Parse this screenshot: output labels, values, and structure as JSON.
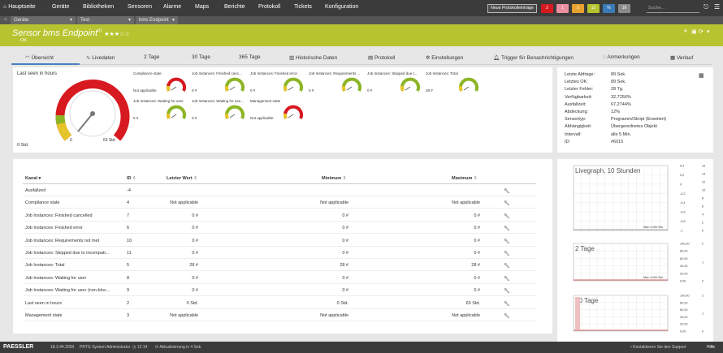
{
  "topnav": {
    "home": "Hauptseite",
    "items": [
      "Geräte",
      "Bibliotheken",
      "Sensoren",
      "Alarme",
      "Maps",
      "Berichte",
      "Protokoll",
      "Tickets",
      "Konfiguration"
    ],
    "newlog": "Neue Protokolleinträge",
    "search_placeholder": "Suche...",
    "chips": [
      {
        "v": "2",
        "c": "#d71920"
      },
      {
        "v": "1",
        "c": "#e98fa0"
      },
      {
        "v": "5",
        "c": "#e7a12e"
      },
      {
        "v": "12",
        "c": "#8cb526"
      },
      {
        "v": "%",
        "c": "#3a7bb7"
      },
      {
        "v": "16",
        "c": "#8a8a8a"
      }
    ]
  },
  "breadcrumb": [
    "Geräte",
    "Test",
    "bms Endpoint"
  ],
  "header": {
    "title": "Sensor bms Endpoint",
    "badge": "ID",
    "status": "OK",
    "stars": "★★★☆☆"
  },
  "tabs": [
    {
      "label": "Übersicht"
    },
    {
      "label": "Livedaten"
    },
    {
      "label": "2 Tage"
    },
    {
      "label": "30 Tage"
    },
    {
      "label": "365 Tage"
    },
    {
      "label": "Historische Daten"
    },
    {
      "label": "Protokoll"
    },
    {
      "label": "Einstellungen"
    },
    {
      "label": "Trigger für Benachrichtigungen"
    },
    {
      "label": "Anmerkungen"
    },
    {
      "label": "Verlauf"
    }
  ],
  "big_gauge": {
    "title": "Last seen in hours",
    "value": "0 Std.",
    "min": "0",
    "max": "63 Std."
  },
  "gauges": [
    {
      "title": "Compliance state",
      "value": "Not applicable",
      "kind": "small"
    },
    {
      "title": "Job Instances: Finished canc...",
      "value": "0 #",
      "kind": "small"
    },
    {
      "title": "Job Instances: Finished error",
      "value": "0 #",
      "kind": "small"
    },
    {
      "title": "Job Instances: Requirements ...",
      "value": "0 #",
      "kind": "small"
    },
    {
      "title": "Job Instances: Skipped due t...",
      "value": "0 #",
      "kind": "small"
    },
    {
      "title": "Job Instances: Total",
      "value": "28 #",
      "kind": "small"
    },
    {
      "title": "Job Instances: Waiting for user",
      "value": "0 #",
      "kind": "small"
    },
    {
      "title": "Job Instances: Waiting for use...",
      "value": "0 #",
      "kind": "small"
    },
    {
      "title": "Management state",
      "value": "Not applicable",
      "kind": "small"
    }
  ],
  "info": [
    {
      "k": "Letzte Abfrage:",
      "v": "89 Sek."
    },
    {
      "k": "Letztes OK:",
      "v": "89 Sek."
    },
    {
      "k": "Letzter Fehler:",
      "v": "28 Tg."
    },
    {
      "k": "Verfügbarkeit:",
      "v": "32,7256%"
    },
    {
      "k": "Ausfallzeit:",
      "v": "67,2744%"
    },
    {
      "k": "Abdeckung:",
      "v": "12%"
    },
    {
      "k": "Sensortyp:",
      "v": "Programm/Skript (Erweitert)"
    },
    {
      "k": "Abhängigkeit:",
      "v": "Übergeordnetes Objekt"
    },
    {
      "k": "Intervall:",
      "v": "alle 5 Min."
    },
    {
      "k": "ID:",
      "v": "#6015"
    }
  ],
  "table": {
    "headers": [
      "Kanal",
      "ID",
      "Letzter Wert",
      "Minimum",
      "Maximum"
    ],
    "rows": [
      [
        "Ausfallzeit",
        "-4",
        "",
        "",
        ""
      ],
      [
        "Compliance state",
        "4",
        "Not applicable",
        "Not applicable",
        "Not applicable"
      ],
      [
        "Job Instances: Finished cancelled",
        "7",
        "0 #",
        "0 #",
        "0 #"
      ],
      [
        "Job Instances: Finished error",
        "6",
        "0 #",
        "0 #",
        "0 #"
      ],
      [
        "Job Instances: Requirements not met",
        "10",
        "0 #",
        "0 #",
        "0 #"
      ],
      [
        "Job Instances: Skipped due to incompati...",
        "11",
        "0 #",
        "0 #",
        "0 #"
      ],
      [
        "Job Instances: Total",
        "5",
        "28 #",
        "28 #",
        "28 #"
      ],
      [
        "Job Instances: Waiting for user",
        "8",
        "0 #",
        "0 #",
        "0 #"
      ],
      [
        "Job Instances: Waiting for user (non-bloc...",
        "9",
        "0 #",
        "0 #",
        "0 #"
      ],
      [
        "Last seen in hours",
        "2",
        "0 Std.",
        "0 Std.",
        "63 Std."
      ],
      [
        "Management state",
        "3",
        "Not applicable",
        "Not applicable",
        "Not applicable"
      ]
    ]
  },
  "graphs": [
    {
      "title": "Livegraph, 10 Stunden",
      "max": "Max: 0,000 Std.",
      "ylab": [
        "0,4",
        "0,2",
        "0",
        "-0,2",
        "-0,4",
        "-0,6",
        "-0,8",
        "-1"
      ],
      "ylab2": [
        "16",
        "14",
        "12",
        "10",
        "8",
        "6",
        "4",
        "2",
        "0"
      ]
    },
    {
      "title": "2 Tage",
      "max": "Max: 0,000 Std.",
      "ylab": [
        "100,00",
        "80,00",
        "60,00",
        "40,00",
        "20,00",
        "0,00"
      ],
      "ylab2": [
        "2",
        "1",
        "0"
      ]
    },
    {
      "title": "30 Tage",
      "ylab": [
        "100,00",
        "80,00",
        "60,00",
        "40,00",
        "20,00",
        "0,00"
      ],
      "ylab2": [
        "2",
        "1",
        "0"
      ]
    }
  ],
  "footer": {
    "brand": "PAESSLER",
    "version": "18.3.44.2059",
    "user": "PRTG System Administrator",
    "time": "12:14",
    "update": "Aktualisierung in 4 Sek.",
    "support": "Kontaktieren Sie den Support",
    "help": "Hilfe"
  },
  "colors": {
    "header": "#b8c42f",
    "nav": "#3b3b3b",
    "accent": "#4a7fc0",
    "red": "#d71920",
    "yellow": "#e6c42b",
    "green": "#8cb526"
  }
}
